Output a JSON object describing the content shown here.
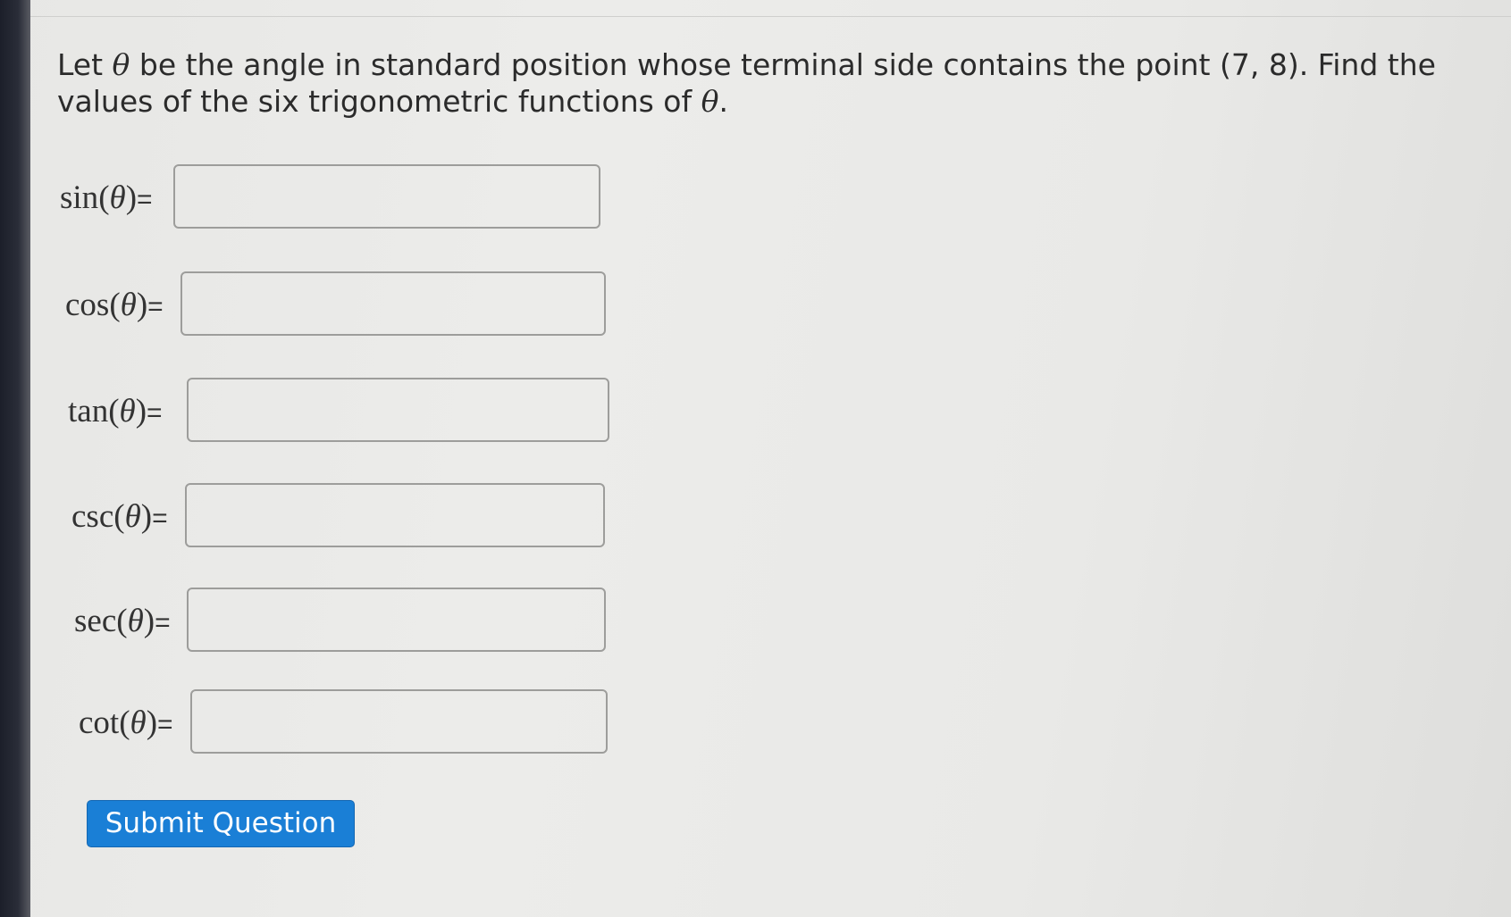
{
  "question": {
    "part1": "Let ",
    "theta": "θ",
    "part2": " be the angle in standard position whose terminal side contains the point (7, 8). Find the values of the six trigonometric functions of ",
    "theta_end": "θ",
    "part3": "."
  },
  "functions": [
    {
      "name": "sin",
      "open": "(",
      "theta": "θ",
      "close": ")",
      "eq": "=",
      "value": ""
    },
    {
      "name": "cos",
      "open": "(",
      "theta": "θ",
      "close": ")",
      "eq": "=",
      "value": ""
    },
    {
      "name": "tan",
      "open": "(",
      "theta": "θ",
      "close": ")",
      "eq": "=",
      "value": ""
    },
    {
      "name": "csc",
      "open": "(",
      "theta": "θ",
      "close": ")",
      "eq": "=",
      "value": ""
    },
    {
      "name": "sec",
      "open": "(",
      "theta": "θ",
      "close": ")",
      "eq": "=",
      "value": ""
    },
    {
      "name": "cot",
      "open": "(",
      "theta": "θ",
      "close": ")",
      "eq": "=",
      "value": ""
    }
  ],
  "submit": {
    "label": "Submit Question"
  },
  "colors": {
    "button": "#1a7fd6",
    "background": "#e9e9e7"
  }
}
